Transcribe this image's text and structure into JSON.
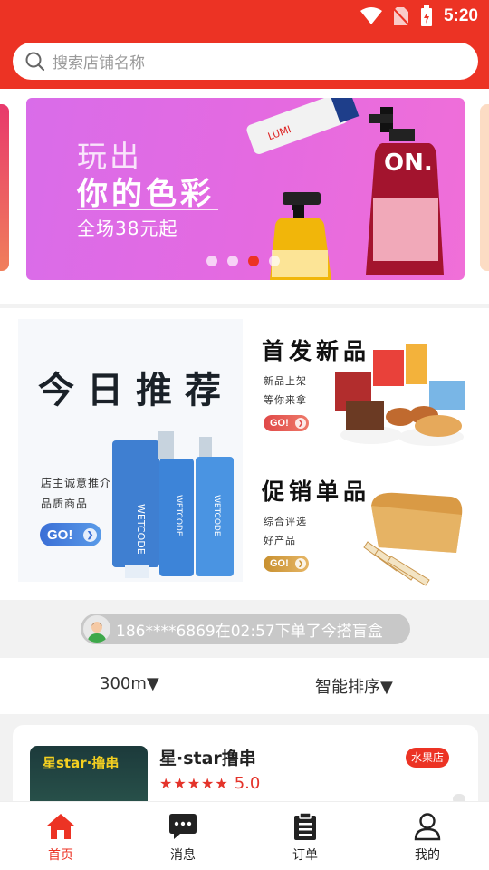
{
  "status_bar": {
    "time": "5:20"
  },
  "search": {
    "placeholder": "搜索店铺名称"
  },
  "banner": {
    "line1": "玩出",
    "line2": "你的色彩",
    "line3": "全场38元起",
    "dot_count": 4,
    "active_dot": 2
  },
  "promo": {
    "main_title": "今日推荐",
    "main_sub1": "店主诚意推介",
    "main_sub2": "品质商品",
    "main_go": "GO!",
    "new_title": "首发新品",
    "new_sub1": "新品上架",
    "new_sub2": "等你来拿",
    "new_go": "GO!",
    "sale_title": "促销单品",
    "sale_sub1": "综合评选",
    "sale_sub2": "好产品",
    "sale_go": "GO!",
    "bottle_brand": "WETCODE"
  },
  "ticker": {
    "text": "186****6869在02:57下单了今搭盲盒"
  },
  "filters": {
    "distance": "300m▼",
    "sort": "智能排序▼"
  },
  "shops": [
    {
      "name": "星·star撸串",
      "tag": "水果店",
      "rating": "5.0",
      "stars": 5,
      "thumb_text": "星star·撸串"
    }
  ],
  "tabs": [
    {
      "label": "首页",
      "icon": "home-icon"
    },
    {
      "label": "消息",
      "icon": "message-icon"
    },
    {
      "label": "订单",
      "icon": "clipboard-icon"
    },
    {
      "label": "我的",
      "icon": "user-icon"
    }
  ],
  "colors": {
    "primary": "#ec3324",
    "banner": "#e56ae0"
  }
}
